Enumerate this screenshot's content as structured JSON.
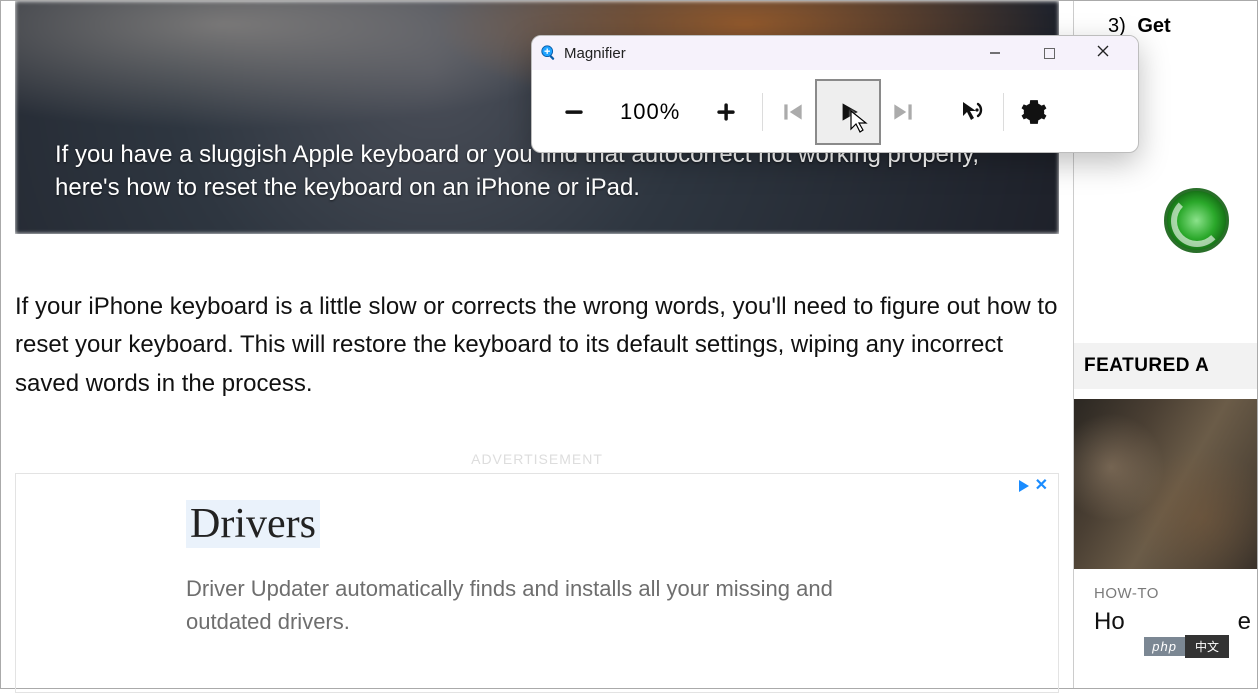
{
  "magnifier": {
    "title": "Magnifier",
    "zoom_level": "100%",
    "icons": {
      "minus": "minus-icon",
      "plus": "plus-icon",
      "prev": "previous-icon",
      "play": "play-icon",
      "next": "next-icon",
      "cursor_sound": "cursor-sound-icon",
      "settings": "gear-icon",
      "minimize": "minimize-icon",
      "maximize": "maximize-icon",
      "close": "close-icon",
      "app": "magnifier-app-icon"
    }
  },
  "article": {
    "hero_text": "If you have a sluggish Apple keyboard or you find that autocorrect not working properly, here's how to reset the keyboard on an iPhone or iPad.",
    "body_p1": "If your iPhone keyboard is a little slow or corrects the wrong words, you'll need to figure out how to reset your keyboard. This will restore the keyboard to its default settings, wiping any incorrect saved words in the process."
  },
  "ad": {
    "label": "ADVERTISEMENT",
    "title": "Drivers",
    "desc": "Driver Updater automatically finds and installs all your missing and outdated drivers."
  },
  "sidebar": {
    "list_num": "3)",
    "list_text": "Get",
    "featured_heading": "FEATURED A",
    "category": "HOW-TO",
    "article_title": "Ho",
    "article_suffix": "e"
  },
  "badge": {
    "left": "php",
    "right": "中文"
  }
}
